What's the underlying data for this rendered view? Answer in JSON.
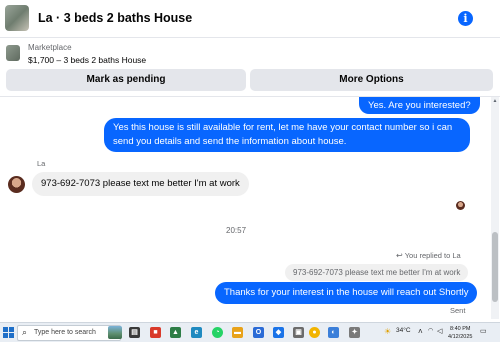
{
  "header": {
    "title": "La · 3 beds 2 baths House",
    "info_icon": "info-icon",
    "info_glyph": "i"
  },
  "marketplace": {
    "label": "Marketplace",
    "item": "$1,700 – 3 beds 2 baths House"
  },
  "actions": {
    "mark_pending": "Mark as pending",
    "more_options": "More Options"
  },
  "messages": [
    {
      "direction": "outgoing",
      "text": "Yes. Are you interested?"
    },
    {
      "direction": "outgoing",
      "text": "Yes this house is still available for rent, let me have your contact number so i can send you details and send the information about house."
    },
    {
      "direction": "incoming",
      "sender": "La",
      "text": "973-692-7073 please text me better I'm at work"
    },
    {
      "direction": "outgoing",
      "text": "Thanks for your interest in the house will reach out Shortly"
    }
  ],
  "timestamp": "20:57",
  "reply_context": {
    "label": "You replied to La",
    "quoted_text": "973-692-7073 please text me better I'm at work"
  },
  "status": "Sent",
  "taskbar": {
    "search_placeholder": "Type here to search",
    "temperature": "34°C",
    "time": "8:40 PM",
    "date": "4/12/2025"
  },
  "colors": {
    "accent": "#0866ff",
    "incoming_bubble": "#f0f0f0",
    "button_bg": "#e4e6eb"
  }
}
